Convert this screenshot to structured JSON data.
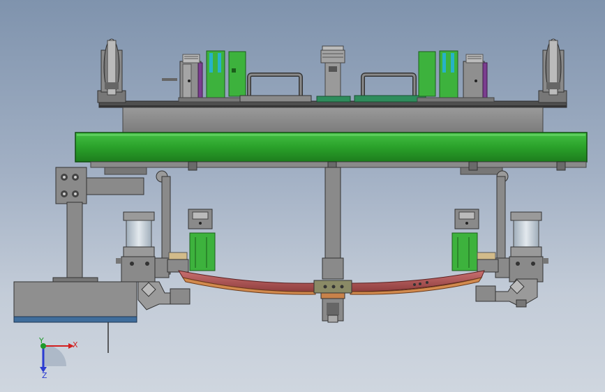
{
  "view": {
    "background_top": "#7f93ad",
    "background_bottom": "#cfd6df"
  },
  "colors": {
    "frame_gray": "#8a8a8a",
    "frame_dark": "#555555",
    "beam_green": "#2aa12a",
    "clamp_green": "#3db23d",
    "spring_red": "#b35858",
    "block_blue": "#3f6d9b",
    "cylinder_glass": "#c9d3dc",
    "purple_plate": "#7b3d8f",
    "cyan_marker": "#27b2c8"
  },
  "triad": {
    "x_label": "X",
    "y_label": "Y",
    "z_label": "Z",
    "x_color": "#d21f1f",
    "y_color": "#1f9a2a",
    "z_color": "#2b3bd1"
  }
}
